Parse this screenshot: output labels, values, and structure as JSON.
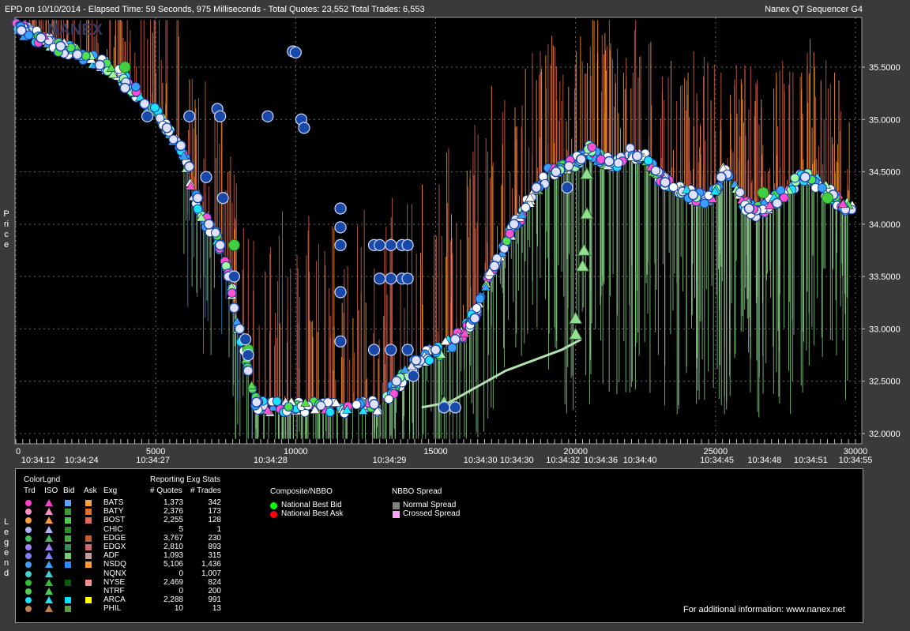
{
  "title": {
    "left": "EPD on 10/10/2014  -  Elapsed Time: 59 Seconds, 975 Milliseconds  -  Total Quotes: 23,552  Total Trades: 6,553",
    "right": "Nanex QT Sequencer G4"
  },
  "watermark": "NANEX",
  "chart_data": {
    "type": "scatter",
    "ylabel": "Price",
    "xlim": [
      0,
      30000
    ],
    "ylim": [
      31.93,
      35.95
    ],
    "x_ticks": [
      {
        "v": 0,
        "label": "0"
      },
      {
        "v": 5000,
        "label": "5000"
      },
      {
        "v": 10000,
        "label": "10000"
      },
      {
        "v": 15000,
        "label": "15000"
      },
      {
        "v": 20000,
        "label": "20000"
      },
      {
        "v": 25000,
        "label": "25000"
      },
      {
        "v": 30000,
        "label": "30000"
      }
    ],
    "time_ticks": [
      {
        "v": 800,
        "label": "10:34:12"
      },
      {
        "v": 2350,
        "label": "10:34:24"
      },
      {
        "v": 4900,
        "label": "10:34:27"
      },
      {
        "v": 9100,
        "label": "10:34:28"
      },
      {
        "v": 13350,
        "label": "10:34:29"
      },
      {
        "v": 16600,
        "label": "10:34:30"
      },
      {
        "v": 17900,
        "label": "10:34:30"
      },
      {
        "v": 19550,
        "label": "10:34:32"
      },
      {
        "v": 20900,
        "label": "10:34:36"
      },
      {
        "v": 22300,
        "label": "10:34:40"
      },
      {
        "v": 25050,
        "label": "10:34:45"
      },
      {
        "v": 26750,
        "label": "10:34:48"
      },
      {
        "v": 28400,
        "label": "10:34:51"
      },
      {
        "v": 30000,
        "label": "10:34:55"
      }
    ],
    "y_ticks": [
      {
        "v": 35.5,
        "label": "35.5000"
      },
      {
        "v": 35.0,
        "label": "35.0000"
      },
      {
        "v": 34.5,
        "label": "34.5000"
      },
      {
        "v": 34.0,
        "label": "34.0000"
      },
      {
        "v": 33.5,
        "label": "33.5000"
      },
      {
        "v": 33.0,
        "label": "33.0000"
      },
      {
        "v": 32.5,
        "label": "32.5000"
      },
      {
        "v": 32.0,
        "label": "32.0000"
      }
    ],
    "nbbo_path": [
      [
        0,
        35.88
      ],
      [
        500,
        35.82
      ],
      [
        1000,
        35.76
      ],
      [
        1500,
        35.7
      ],
      [
        2000,
        35.65
      ],
      [
        2500,
        35.6
      ],
      [
        3000,
        35.55
      ],
      [
        3500,
        35.48
      ],
      [
        4000,
        35.35
      ],
      [
        4500,
        35.2
      ],
      [
        5000,
        35.05
      ],
      [
        5500,
        34.9
      ],
      [
        6000,
        34.65
      ],
      [
        6300,
        34.35
      ],
      [
        6600,
        34.1
      ],
      [
        7000,
        33.95
      ],
      [
        7400,
        33.75
      ],
      [
        7700,
        33.4
      ],
      [
        7900,
        33.05
      ],
      [
        8200,
        32.75
      ],
      [
        8500,
        32.3
      ],
      [
        9000,
        32.25
      ],
      [
        10000,
        32.25
      ],
      [
        11000,
        32.25
      ],
      [
        12000,
        32.25
      ],
      [
        13000,
        32.27
      ],
      [
        13500,
        32.42
      ],
      [
        14000,
        32.6
      ],
      [
        14500,
        32.72
      ],
      [
        15000,
        32.78
      ],
      [
        15500,
        32.85
      ],
      [
        16000,
        32.95
      ],
      [
        16500,
        33.2
      ],
      [
        17000,
        33.55
      ],
      [
        17500,
        33.85
      ],
      [
        18000,
        34.05
      ],
      [
        18500,
        34.3
      ],
      [
        19000,
        34.48
      ],
      [
        19500,
        34.55
      ],
      [
        20000,
        34.6
      ],
      [
        20500,
        34.72
      ],
      [
        21000,
        34.6
      ],
      [
        21500,
        34.6
      ],
      [
        22000,
        34.68
      ],
      [
        22500,
        34.65
      ],
      [
        23000,
        34.45
      ],
      [
        23500,
        34.35
      ],
      [
        24000,
        34.28
      ],
      [
        24500,
        34.25
      ],
      [
        25000,
        34.28
      ],
      [
        25300,
        34.55
      ],
      [
        25700,
        34.35
      ],
      [
        26000,
        34.18
      ],
      [
        26500,
        34.12
      ],
      [
        27000,
        34.2
      ],
      [
        27500,
        34.3
      ],
      [
        28000,
        34.45
      ],
      [
        28500,
        34.42
      ],
      [
        29000,
        34.3
      ],
      [
        29500,
        34.2
      ],
      [
        30000,
        34.15
      ]
    ],
    "trade_cloud": [
      [
        200,
        35.85
      ],
      [
        900,
        35.78
      ],
      [
        1600,
        35.7
      ],
      [
        2200,
        35.62
      ],
      [
        3000,
        35.52
      ],
      [
        3900,
        35.3
      ],
      [
        4600,
        35.15
      ],
      [
        5400,
        34.92
      ],
      [
        5900,
        34.75
      ],
      [
        6200,
        34.55
      ],
      [
        6500,
        34.25
      ],
      [
        6900,
        34.0
      ],
      [
        7300,
        33.8
      ],
      [
        7600,
        33.5
      ],
      [
        7800,
        33.2
      ],
      [
        8000,
        33.0
      ],
      [
        8300,
        32.6
      ],
      [
        8600,
        32.3
      ],
      [
        12800,
        32.28
      ],
      [
        13600,
        32.5
      ],
      [
        14300,
        32.7
      ],
      [
        15000,
        32.8
      ],
      [
        15700,
        32.9
      ],
      [
        16400,
        33.1
      ],
      [
        17100,
        33.6
      ],
      [
        17800,
        34.0
      ],
      [
        18600,
        34.35
      ],
      [
        19300,
        34.5
      ],
      [
        20200,
        34.62
      ],
      [
        21200,
        34.6
      ],
      [
        22200,
        34.65
      ],
      [
        23200,
        34.4
      ],
      [
        24200,
        34.28
      ],
      [
        25200,
        34.45
      ],
      [
        26200,
        34.15
      ],
      [
        27200,
        34.2
      ],
      [
        28200,
        34.45
      ],
      [
        29200,
        34.28
      ]
    ],
    "blue_dots": [
      [
        4700,
        35.03
      ],
      [
        6200,
        35.03
      ],
      [
        7200,
        35.1
      ],
      [
        7300,
        35.03
      ],
      [
        9000,
        35.03
      ],
      [
        9900,
        35.65
      ],
      [
        10000,
        35.64
      ],
      [
        10200,
        35.0
      ],
      [
        10300,
        34.92
      ],
      [
        11600,
        34.15
      ],
      [
        11600,
        33.97
      ],
      [
        11600,
        33.8
      ],
      [
        11600,
        33.35
      ],
      [
        11600,
        32.88
      ],
      [
        12800,
        33.8
      ],
      [
        13000,
        33.8
      ],
      [
        13400,
        33.8
      ],
      [
        13800,
        33.8
      ],
      [
        14000,
        33.8
      ],
      [
        13000,
        33.48
      ],
      [
        13400,
        33.48
      ],
      [
        13800,
        33.48
      ],
      [
        14000,
        33.48
      ],
      [
        12800,
        32.8
      ],
      [
        13400,
        32.8
      ],
      [
        14000,
        32.8
      ],
      [
        6800,
        34.45
      ],
      [
        7400,
        34.25
      ],
      [
        7800,
        33.5
      ],
      [
        8200,
        32.9
      ],
      [
        8300,
        32.75
      ],
      [
        15300,
        32.25
      ],
      [
        15700,
        32.25
      ],
      [
        19700,
        34.35
      ],
      [
        14200,
        32.55
      ]
    ],
    "green_dots": [
      [
        3900,
        35.5
      ],
      [
        7800,
        33.8
      ],
      [
        8300,
        32.8
      ],
      [
        29000,
        34.25
      ],
      [
        26700,
        34.3
      ]
    ],
    "green_triangles": [
      [
        20400,
        34.1
      ],
      [
        20300,
        33.75
      ],
      [
        20250,
        33.6
      ],
      [
        20000,
        33.1
      ],
      [
        20000,
        32.95
      ],
      [
        20400,
        34.48
      ],
      [
        15300,
        32.3
      ]
    ],
    "diag_path": [
      [
        14500,
        32.25
      ],
      [
        15500,
        32.3
      ],
      [
        16500,
        32.45
      ],
      [
        17500,
        32.6
      ],
      [
        18500,
        32.7
      ],
      [
        19500,
        32.8
      ],
      [
        20200,
        32.9
      ]
    ]
  },
  "legend": {
    "vlabel": "Legend",
    "colorlgnd_title": "ColorLgnd",
    "col_trd": "Trd",
    "col_iso": "ISO",
    "col_bid": "Bid",
    "col_ask": "Ask",
    "col_exg": "Exg",
    "stats_title": "Reporting Exg Stats",
    "col_quotes": "# Quotes",
    "col_trades": "# Trades",
    "exchanges": [
      {
        "name": "BATS",
        "quotes": "1,373",
        "trades": "342",
        "trd": "#ff3fd0",
        "bid": "#5aa0ff",
        "ask": "#ff9f3f"
      },
      {
        "name": "BATY",
        "quotes": "2,376",
        "trades": "173",
        "trd": "#ff8fc8",
        "bid": "#3a9a3a",
        "ask": "#e86a2e"
      },
      {
        "name": "BOST",
        "quotes": "2,255",
        "trades": "128",
        "trd": "#ff9a3f",
        "bid": "#50c850",
        "ask": "#e06a5a"
      },
      {
        "name": "CHIC",
        "quotes": "5",
        "trades": "1",
        "trd": "#b0b0ff",
        "bid": "#2e8a2e",
        "ask": ""
      },
      {
        "name": "EDGE",
        "quotes": "3,767",
        "trades": "230",
        "trd": "#40c060",
        "bid": "#4aa84a",
        "ask": "#c05a3a"
      },
      {
        "name": "EDGX",
        "quotes": "2,810",
        "trades": "893",
        "trd": "#a080ff",
        "bid": "#3a8a5a",
        "ask": "#d06a6a"
      },
      {
        "name": "ADF",
        "quotes": "1,093",
        "trades": "315",
        "trd": "#8080ff",
        "bid": "#7ac87a",
        "ask": "#c89a9a"
      },
      {
        "name": "NSDQ",
        "quotes": "5,106",
        "trades": "1,436",
        "trd": "#3aa0ff",
        "bid": "#2a8aff",
        "ask": "#ff9a2a"
      },
      {
        "name": "NQNX",
        "quotes": "0",
        "trades": "1,007",
        "trd": "#40d0d0",
        "bid": "",
        "ask": ""
      },
      {
        "name": "NYSE",
        "quotes": "2,469",
        "trades": "824",
        "trd": "#30c030",
        "bid": "#0a5a0a",
        "ask": "#ff8f8f"
      },
      {
        "name": "NTRF",
        "quotes": "0",
        "trades": "200",
        "trd": "#50d050",
        "bid": "",
        "ask": ""
      },
      {
        "name": "ARCA",
        "quotes": "2,288",
        "trades": "991",
        "trd": "#20e0ff",
        "bid": "#00e0ff",
        "ask": "#ffff00"
      },
      {
        "name": "PHIL",
        "quotes": "10",
        "trades": "13",
        "trd": "#c08050",
        "bid": "#60a040",
        "ask": ""
      }
    ],
    "composite_title": "Composite/NBBO",
    "national_best_bid": "National Best Bid",
    "national_best_ask": "National Best Ask",
    "bid_color": "#00ff00",
    "ask_color": "#ff0000",
    "spread_title": "NBBO Spread",
    "normal_spread": "Normal Spread",
    "crossed_spread": "Crossed Spread",
    "normal_color": "#808080",
    "crossed_color": "#ffa0ff"
  },
  "footer": "For additional information: www.nanex.net",
  "colors": {
    "background": "#3a3a3a",
    "plot_bg": "#000000",
    "grid": "#9a9a9a",
    "red_line": "#d0604a",
    "orange_line": "#ff9a2a",
    "green_line": "#8ad08a",
    "blue_dot": "#1848a8",
    "trade_white": "#e0e0ff"
  }
}
